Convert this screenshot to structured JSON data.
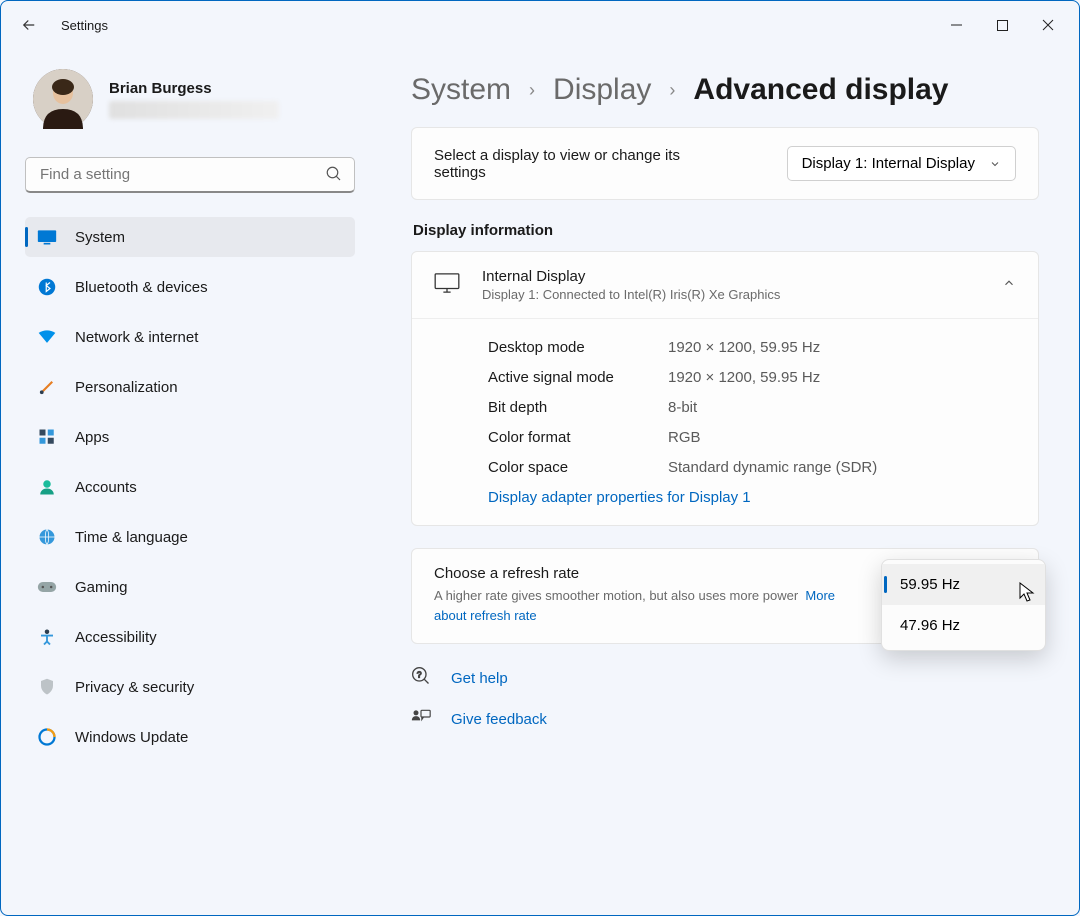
{
  "window": {
    "title": "Settings"
  },
  "user": {
    "name": "Brian Burgess"
  },
  "search": {
    "placeholder": "Find a setting"
  },
  "nav": [
    {
      "label": "System"
    },
    {
      "label": "Bluetooth & devices"
    },
    {
      "label": "Network & internet"
    },
    {
      "label": "Personalization"
    },
    {
      "label": "Apps"
    },
    {
      "label": "Accounts"
    },
    {
      "label": "Time & language"
    },
    {
      "label": "Gaming"
    },
    {
      "label": "Accessibility"
    },
    {
      "label": "Privacy & security"
    },
    {
      "label": "Windows Update"
    }
  ],
  "breadcrumb": {
    "a": "System",
    "b": "Display",
    "c": "Advanced display"
  },
  "selector": {
    "label": "Select a display to view or change its settings",
    "value": "Display 1: Internal Display"
  },
  "section1": "Display information",
  "info": {
    "title": "Internal Display",
    "sub": "Display 1: Connected to Intel(R) Iris(R) Xe Graphics",
    "rows": {
      "desktop_mode_k": "Desktop mode",
      "desktop_mode_v": "1920 × 1200, 59.95 Hz",
      "active_signal_k": "Active signal mode",
      "active_signal_v": "1920 × 1200, 59.95 Hz",
      "bit_depth_k": "Bit depth",
      "bit_depth_v": "8-bit",
      "color_format_k": "Color format",
      "color_format_v": "RGB",
      "color_space_k": "Color space",
      "color_space_v": "Standard dynamic range (SDR)"
    },
    "adapter_link": "Display adapter properties for Display 1"
  },
  "rate": {
    "title": "Choose a refresh rate",
    "sub": "A higher rate gives smoother motion, but also uses more power",
    "more": "More about refresh rate",
    "options": {
      "o1": "59.95 Hz",
      "o2": "47.96 Hz"
    }
  },
  "footer": {
    "help": "Get help",
    "feedback": "Give feedback"
  }
}
